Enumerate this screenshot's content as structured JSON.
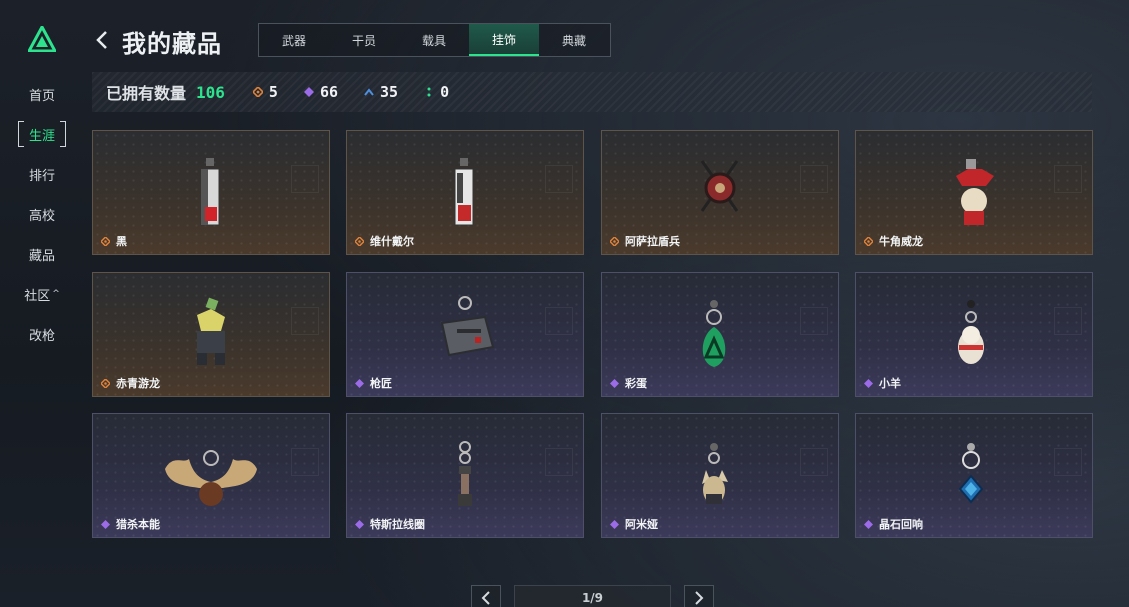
{
  "sidebar": {
    "logo_icon": "triangle-logo",
    "items": [
      {
        "label": "首页"
      },
      {
        "label": "生涯",
        "active": true
      },
      {
        "label": "排行"
      },
      {
        "label": "高校"
      },
      {
        "label": "藏品"
      },
      {
        "label": "社区",
        "caret": "^"
      },
      {
        "label": "改枪"
      }
    ]
  },
  "header": {
    "back_icon": "chevron-left-icon",
    "title": "我的藏品",
    "tabs": [
      {
        "label": "武器"
      },
      {
        "label": "干员"
      },
      {
        "label": "载具"
      },
      {
        "label": "挂饰",
        "active": true
      },
      {
        "label": "典藏"
      }
    ]
  },
  "stats": {
    "owned_label": "已拥有数量",
    "owned_total": "106",
    "rarities": [
      {
        "icon": "orange-gem-icon",
        "color": "#e0823a",
        "count": "5"
      },
      {
        "icon": "purple-gem-icon",
        "color": "#9b6be8",
        "count": "66"
      },
      {
        "icon": "blue-gem-icon",
        "color": "#4f8fe0",
        "count": "35"
      },
      {
        "icon": "green-gem-icon",
        "color": "#2de38e",
        "count": "0"
      }
    ]
  },
  "items": [
    {
      "name": "黑",
      "rarity": "orange"
    },
    {
      "name": "维什戴尔",
      "rarity": "orange"
    },
    {
      "name": "阿萨拉盾兵",
      "rarity": "orange"
    },
    {
      "name": "牛角威龙",
      "rarity": "orange"
    },
    {
      "name": "赤青游龙",
      "rarity": "orange"
    },
    {
      "name": "枪匠",
      "rarity": "purple"
    },
    {
      "name": "彩蛋",
      "rarity": "purple"
    },
    {
      "name": "小羊",
      "rarity": "purple"
    },
    {
      "name": "猎杀本能",
      "rarity": "purple"
    },
    {
      "name": "特斯拉线圈",
      "rarity": "purple"
    },
    {
      "name": "阿米娅",
      "rarity": "purple"
    },
    {
      "name": "晶石回响",
      "rarity": "purple"
    }
  ],
  "pagination": {
    "indicator": "1/9",
    "current": 1,
    "total": 9
  },
  "colors": {
    "accent": "#2de38e",
    "orange": "#e0823a",
    "purple": "#9b6be8"
  }
}
